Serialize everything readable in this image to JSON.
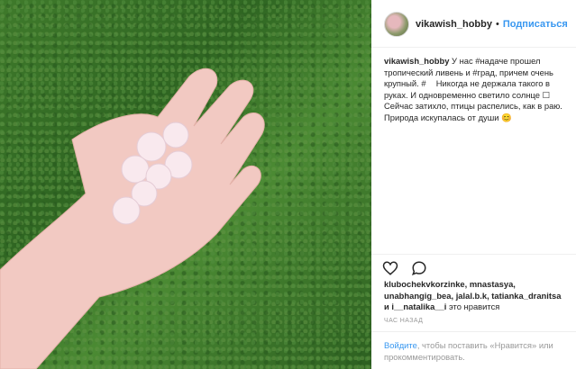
{
  "post": {
    "photo_alt": "hand holding hailstones on grass",
    "header": {
      "username": "vikawish_hobby",
      "separator": "•",
      "follow_label": "Подписаться"
    },
    "caption": {
      "username": "vikawish_hobby",
      "text": "У нас #надаче прошел тропический ливень и #град, причем очень крупный. #ᅠ Никогда не держала такого в руках. И одновременно светило солнце ☐ Сейчас затихло, птицы распелись, как в раю. Природа искупалась от души 😊"
    },
    "actions": {
      "like_icon": "heart-icon",
      "comment_icon": "comment-icon"
    },
    "likes": {
      "line1": "klubochekvkorzinke, mnastasya,",
      "line2": "unabhangig_bea, jalal.b.k, tatianka_dranitsa",
      "line3_users": "и i__natalika__i",
      "line3_suffix": "это нравится"
    },
    "timestamp": "час назад",
    "login": {
      "link": "Войдите",
      "rest": ", чтобы поставить «Нравится» или прокомментировать."
    }
  }
}
